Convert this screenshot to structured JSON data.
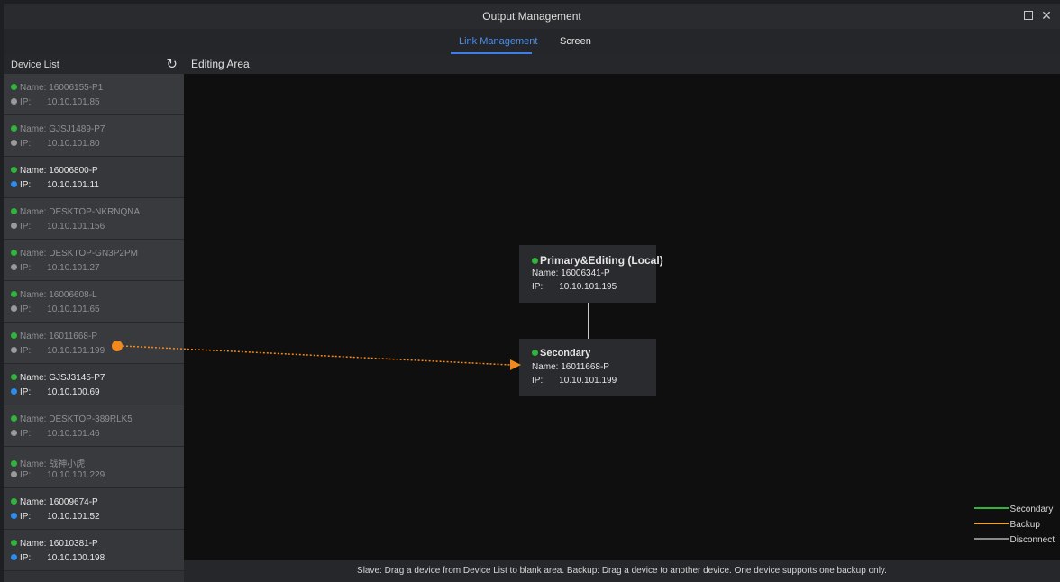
{
  "window": {
    "title": "Output Management",
    "maximize_icon": "maximize-icon",
    "close_icon": "close-icon",
    "close_glyph": "✕"
  },
  "tabs": [
    {
      "label": "Link Management",
      "active": true
    },
    {
      "label": "Screen",
      "active": false
    }
  ],
  "device_list": {
    "title": "Device List",
    "refresh_icon": "refresh-icon",
    "refresh_glyph": "↻",
    "name_label": "Name: ",
    "ip_label": "IP:",
    "items": [
      {
        "name": "16006155-P1",
        "ip": "10.10.101.85",
        "online": false,
        "ip_dot": "gray"
      },
      {
        "name": "GJSJ1489-P7",
        "ip": "10.10.101.80",
        "online": false,
        "ip_dot": "gray"
      },
      {
        "name": "16006800-P",
        "ip": "10.10.101.11",
        "online": true,
        "ip_dot": "blue"
      },
      {
        "name": "DESKTOP-NKRNQNA",
        "ip": "10.10.101.156",
        "online": false,
        "ip_dot": "gray"
      },
      {
        "name": "DESKTOP-GN3P2PM",
        "ip": "10.10.101.27",
        "online": false,
        "ip_dot": "gray"
      },
      {
        "name": "16006608-L",
        "ip": "10.10.101.65",
        "online": false,
        "ip_dot": "gray"
      },
      {
        "name": "16011668-P",
        "ip": "10.10.101.199",
        "online": false,
        "ip_dot": "gray"
      },
      {
        "name": "GJSJ3145-P7",
        "ip": "10.10.100.69",
        "online": true,
        "ip_dot": "blue"
      },
      {
        "name": "DESKTOP-389RLK5",
        "ip": "10.10.101.46",
        "online": false,
        "ip_dot": "gray"
      },
      {
        "name": "战神小虎",
        "ip": "10.10.101.229",
        "online": false,
        "ip_dot": "gray"
      },
      {
        "name": "16009674-P",
        "ip": "10.10.101.52",
        "online": true,
        "ip_dot": "blue"
      },
      {
        "name": "16010381-P",
        "ip": "10.10.100.198",
        "online": true,
        "ip_dot": "blue"
      }
    ]
  },
  "editing_area": {
    "title": "Editing Area",
    "primary": {
      "title": "Primary&Editing (Local)",
      "name": "Name: 16006341-P",
      "ip_label": "IP:",
      "ip": "10.10.101.195"
    },
    "secondary": {
      "title": "Secondary",
      "name": "Name: 16011668-P",
      "ip_label": "IP:",
      "ip": "10.10.101.199"
    },
    "legend": [
      {
        "label": "Secondary",
        "color": "#2fb53a"
      },
      {
        "label": "Backup",
        "color": "#f0a23a"
      },
      {
        "label": "Disconnect",
        "color": "#8a8a8a"
      }
    ]
  },
  "hint": "Slave: Drag a device from Device List to blank area. Backup: Drag a device to another device. One device supports one backup only.",
  "colors": {
    "accent": "#3d7fe6",
    "drag": "#f08a1e",
    "online": "#2fb53a"
  }
}
